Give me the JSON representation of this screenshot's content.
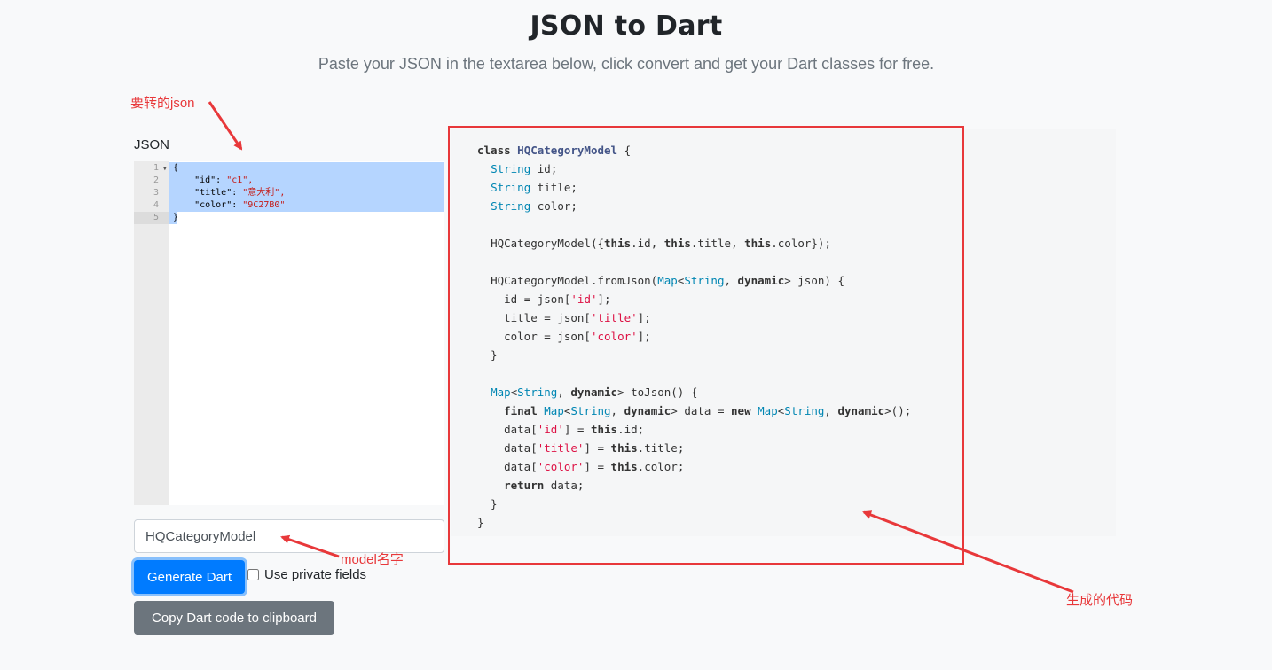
{
  "header": {
    "title": "JSON to Dart",
    "subtitle": "Paste your JSON in the textarea below, click convert and get your Dart classes for free."
  },
  "json_editor": {
    "label": "JSON",
    "line_numbers": [
      "1",
      "2",
      "3",
      "4",
      "5"
    ],
    "lines": [
      {
        "pre": "{",
        "str": ""
      },
      {
        "pre": "    \"id\": ",
        "str": "\"c1\","
      },
      {
        "pre": "    \"title\": ",
        "str": "\"意大利\","
      },
      {
        "pre": "    \"color\": ",
        "str": "\"9C27B0\""
      },
      {
        "pre": "}",
        "str": ""
      }
    ]
  },
  "model_name": {
    "value": "HQCategoryModel"
  },
  "buttons": {
    "generate": "Generate Dart",
    "private_fields": "Use private fields",
    "copy": "Copy Dart code to clipboard"
  },
  "output": {
    "class_name": "HQCategoryModel",
    "fields": [
      "id",
      "title",
      "color"
    ],
    "string_type": "String",
    "map_type": "Map",
    "keywords": [
      "class",
      "this",
      "dynamic",
      "final",
      "new",
      "return"
    ]
  },
  "annotations": {
    "json_note": "要转的json",
    "model_note": "model名字",
    "code_note": "生成的代码"
  },
  "colors": {
    "primary": "#007bff",
    "secondary": "#6c757d",
    "annotation_red": "#e8383a",
    "selection": "#b5d5ff"
  }
}
